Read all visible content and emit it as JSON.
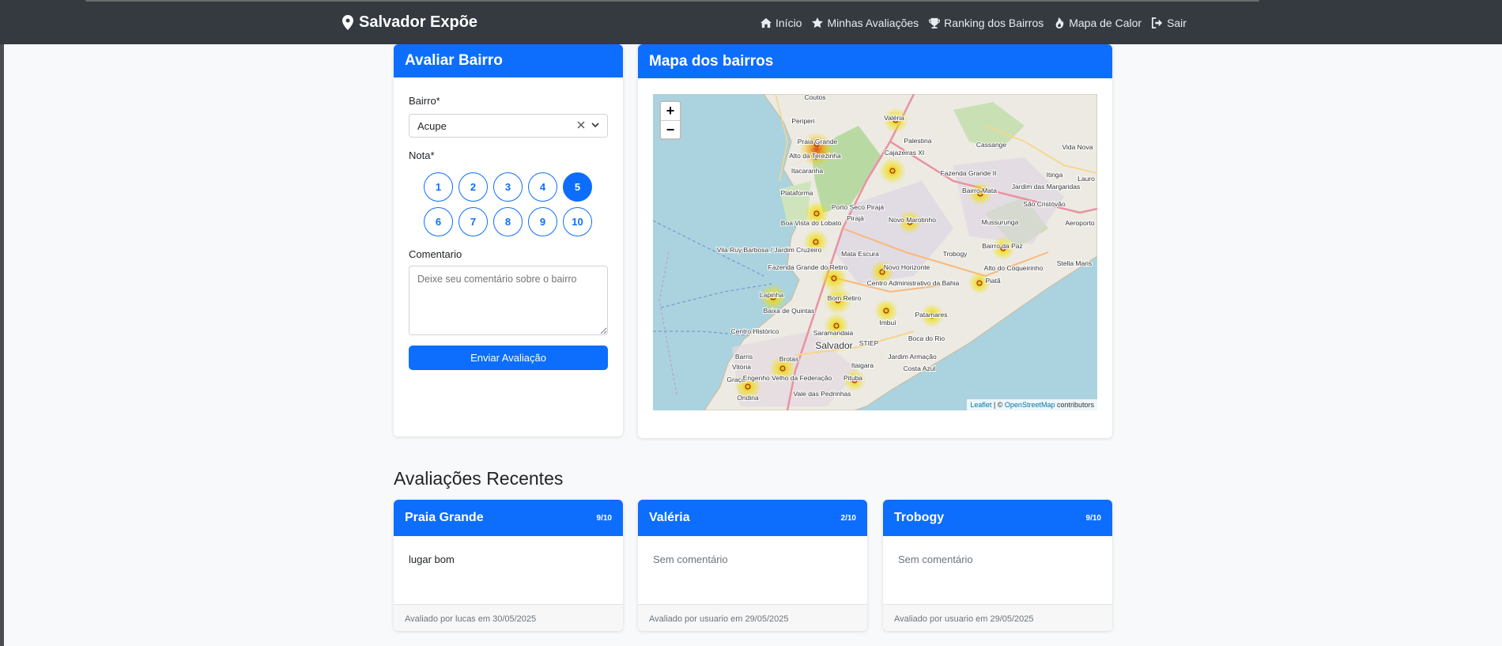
{
  "nav": {
    "brand": "Salvador Expõe",
    "links": [
      {
        "icon": "home-icon",
        "label": "Início"
      },
      {
        "icon": "star-icon",
        "label": "Minhas Avaliações"
      },
      {
        "icon": "trophy-icon",
        "label": "Ranking dos Bairros"
      },
      {
        "icon": "flame-icon",
        "label": "Mapa de Calor"
      },
      {
        "icon": "logout-icon",
        "label": "Sair"
      }
    ]
  },
  "form": {
    "title": "Avaliar Bairro",
    "bairro_label": "Bairro*",
    "bairro_value": "Acupe",
    "nota_label": "Nota*",
    "ratings": [
      "1",
      "2",
      "3",
      "4",
      "5",
      "6",
      "7",
      "8",
      "9",
      "10"
    ],
    "selected_rating": "5",
    "comment_label": "Comentario",
    "comment_placeholder": "Deixe seu comentário sobre o bairro",
    "submit_label": "Enviar Avaliação"
  },
  "map": {
    "title": "Mapa dos bairros",
    "zoom_in": "+",
    "zoom_out": "−",
    "attribution_leaflet": "Leaflet",
    "attribution_sep": " | © ",
    "attribution_osm": "OpenStreetMap",
    "attribution_tail": " contributors",
    "labels": [
      "Coutos",
      "Periperi",
      "Praia Grande",
      "Alto da Terezinha",
      "Itacaranha",
      "Plataforma",
      "Valéria",
      "Palestina",
      "Cajazeiras XI",
      "Cassange",
      "Vida Nova",
      "Fazenda Grande II",
      "Bairro Mata",
      "Jardim das Margaridas",
      "Itinga",
      "São Cristóvão",
      "Boa Vista do Lobato",
      "Porto Seco Pirajá",
      "Pirajá",
      "Novo Marotinho",
      "Mussurunga",
      "Aeroporto",
      "Vila Ruy Barbosa / Jardim Cruzeiro",
      "Mata Escura",
      "Trobogy",
      "Bairro da Paz",
      "Stella Maris",
      "Fazenda Grande do Retiro",
      "Novo Horizonte",
      "Centro Administrativo da Bahia",
      "Alto do Coqueirinho",
      "Piatã",
      "Lapinha",
      "Bom Retiro",
      "Baixa de Quintas",
      "Imbuí",
      "Patamares",
      "Centro Histórico",
      "Saramandaia",
      "STIEP",
      "Boca do Rio",
      "Salvador",
      "Barris",
      "Jardim Armação",
      "Brotas",
      "Itaigara",
      "Costa Azul",
      "Vitória",
      "Graça",
      "Engenho Velho da Federação",
      "Vale das Pedrinhas",
      "Pituba",
      "Ondina",
      "Lauro"
    ],
    "heat_color": "#e8d400"
  },
  "recent": {
    "title": "Avaliações Recentes",
    "reviews": [
      {
        "name": "Praia Grande",
        "score": "9/10",
        "comment": "lugar bom",
        "footer": "Avaliado por lucas em 30/05/2025"
      },
      {
        "name": "Valéria",
        "score": "2/10",
        "comment": "Sem comentário",
        "footer": "Avaliado por usuario em 29/05/2025"
      },
      {
        "name": "Trobogy",
        "score": "9/10",
        "comment": "Sem comentário",
        "footer": "Avaliado por usuario em 29/05/2025"
      }
    ]
  },
  "colors": {
    "primary": "#0d6efd",
    "navbar": "#343a40"
  }
}
